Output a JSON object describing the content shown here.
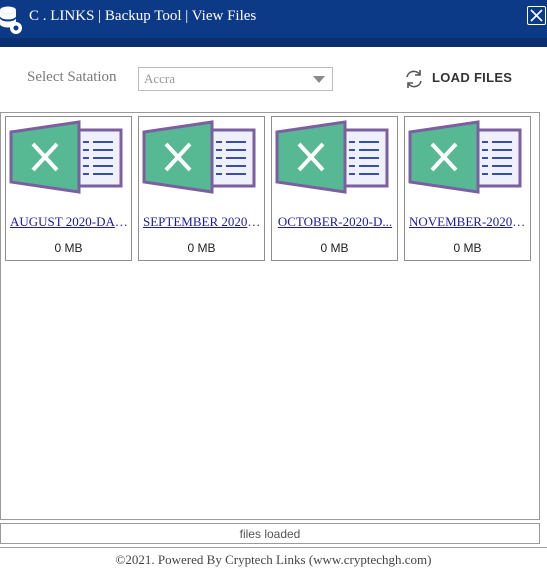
{
  "window": {
    "title": "C . LINKS  | Backup Tool | View Files",
    "close_icon": "close-icon",
    "app_icon": "database-icon",
    "colors": {
      "titlebar": "#0d3a86",
      "titlebar_bottom": "#0a2f6e"
    }
  },
  "toolbar": {
    "station_label": "Select Satation",
    "station_value": "Accra",
    "load_label": "LOAD FILES",
    "load_icon": "refresh-icon"
  },
  "files": [
    {
      "name": "AUGUST 2020-DAI...",
      "size": "0 MB",
      "icon": "excel-file-icon"
    },
    {
      "name": "SEPTEMBER 2020-...",
      "size": "0 MB",
      "icon": "excel-file-icon"
    },
    {
      "name": "OCTOBER-2020-D...",
      "size": "0 MB",
      "icon": "excel-file-icon"
    },
    {
      "name": "NOVEMBER-2020.x...",
      "size": "0 MB",
      "icon": "excel-file-icon"
    }
  ],
  "status": {
    "text": "files loaded"
  },
  "footer": {
    "text": "©2021. Powered By Cryptech Links (www.cryptechgh.com)"
  }
}
